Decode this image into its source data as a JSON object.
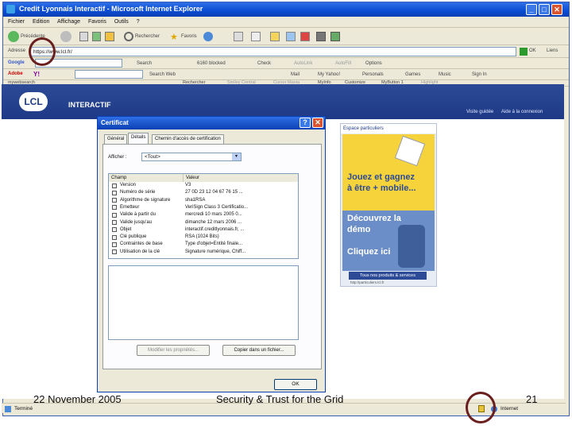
{
  "browser": {
    "title": "Credit Lyonnais Interactif - Microsoft Internet Explorer",
    "menu": [
      "Fichier",
      "Edition",
      "Affichage",
      "Favoris",
      "Outils",
      "?"
    ],
    "toolbar": {
      "back": "Précédente",
      "search": "Rechercher",
      "favorites": "Favoris"
    },
    "address_label": "Adresse",
    "address_value": "https://www.lcl.fr/",
    "go": "OK",
    "links": "Liens",
    "google_bar": [
      "Search",
      "6160 blocked",
      "Check",
      "AutoLink",
      "AutoFill",
      "Options"
    ],
    "yahoo_bar": [
      "Search Web",
      "Mail",
      "My Yahoo!",
      "Personals",
      "Games",
      "Music",
      "Sign In"
    ],
    "msn_bar": [
      "mywebsearch",
      "Rechercher",
      "Smiley Central",
      "Cursor Mania",
      "MyInfo",
      "Customize",
      "MyButton 1",
      "Highlight"
    ],
    "status_left": "Terminé",
    "status_zone": "Internet"
  },
  "lcl": {
    "logo": "LCL",
    "title": "INTERACTIF",
    "links": [
      "Visite guidée",
      "Aide à la connexion"
    ]
  },
  "ad": {
    "header": "Espace particuliers",
    "line1": "Jouez et gagnez",
    "line2": "à être + mobile...",
    "line3": "Découvrez la",
    "line4": "démo",
    "line5": "Cliquez ici",
    "button": "Tous nos produits & services",
    "url": "http://particuliers.lcl.fr"
  },
  "dialog": {
    "title": "Certificat",
    "tabs": [
      "Général",
      "Détails",
      "Chemin d'accès de certification"
    ],
    "show_label": "Afficher :",
    "show_value": "<Tout>",
    "columns": [
      "Champ",
      "Valeur"
    ],
    "rows": [
      {
        "field": "Version",
        "value": "V3"
      },
      {
        "field": "Numéro de série",
        "value": "27 0D 23 12 04 67 76 15 ..."
      },
      {
        "field": "Algorithme de signature",
        "value": "sha1RSA"
      },
      {
        "field": "Émetteur",
        "value": "VeriSign Class 3 Certificatio..."
      },
      {
        "field": "Valide à partir du",
        "value": "mercredi 10 mars 2005 0..."
      },
      {
        "field": "Valide jusqu'au",
        "value": "dimanche 12 mars 2006 ..."
      },
      {
        "field": "Objet",
        "value": "interactif.creditlyonnais.fr, ..."
      },
      {
        "field": "Clé publique",
        "value": "RSA (1024 Bits)"
      },
      {
        "field": "Contraintes de base",
        "value": "Type d'objet=Entité finale..."
      },
      {
        "field": "Utilisation de la clé",
        "value": "Signature numérique, Chiff..."
      }
    ],
    "edit_button": "Modifier les propriétés...",
    "copy_button": "Copier dans un fichier...",
    "ok_button": "OK"
  },
  "slide_footer": {
    "date": "22 November 2005",
    "title": "Security & Trust for the Grid",
    "page": "21"
  }
}
